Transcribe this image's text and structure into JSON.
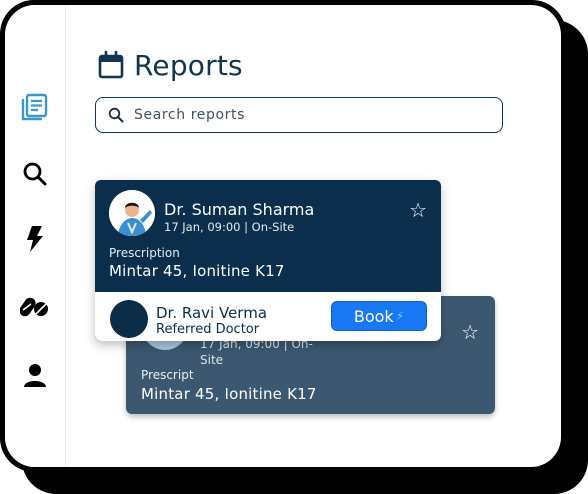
{
  "nav": {
    "items": [
      {
        "icon": "reports-icon",
        "active": true
      },
      {
        "icon": "search-icon",
        "active": false
      },
      {
        "icon": "lightning-icon",
        "active": false
      },
      {
        "icon": "pills-icon",
        "active": false
      },
      {
        "icon": "user-icon",
        "active": false
      }
    ]
  },
  "header": {
    "title": "Reports",
    "icon": "calendar-icon"
  },
  "search": {
    "placeholder": "Search reports"
  },
  "reports": [
    {
      "doctor": "Dr. Suman Sharma",
      "meta": "17 Jan, 09:00 | On-Site",
      "prescription_label": "Prescription",
      "medicines": "Mintar 45, Ionitine K17",
      "starred": false,
      "referral": {
        "doctor": "Dr. Ravi Verma",
        "role": "Referred Doctor",
        "action": "Book"
      }
    },
    {
      "meta": "17 Jan, 09:00 | On-Site",
      "prescription_label": "Prescript",
      "medicines": "Mintar 45, Ionitine K17",
      "starred": false
    }
  ],
  "colors": {
    "primary": "#0a2e4c",
    "secondary_card": "#3c5870",
    "accent": "#1877f2",
    "nav_active": "#3a98c4"
  }
}
